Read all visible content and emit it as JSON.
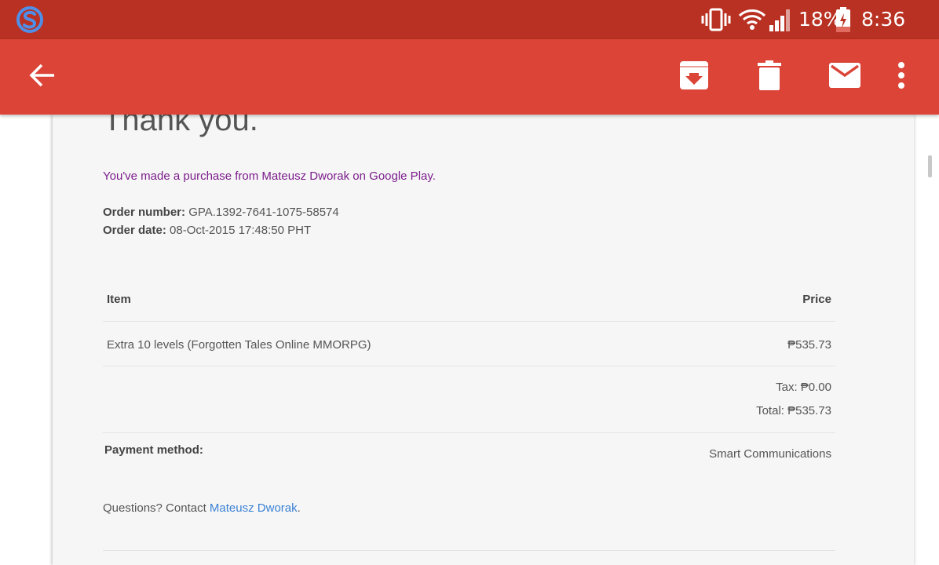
{
  "status_bar": {
    "battery": "18%",
    "time": "8:36 pm",
    "icons": [
      "s-logo-icon",
      "vibrate-icon",
      "wifi-icon",
      "signal-icon",
      "battery-charging-icon"
    ]
  },
  "app_bar": {
    "icons": [
      "back-arrow-icon",
      "archive-icon",
      "delete-icon",
      "mark-unread-icon",
      "more-vert-icon"
    ]
  },
  "email": {
    "headline": "Thank you.",
    "intro": "You've made a purchase from Mateusz Dworak on Google Play.",
    "order_number_label": "Order number:",
    "order_number": "GPA.1392-7641-1075-58574",
    "order_date_label": "Order date:",
    "order_date": "08-Oct-2015 17:48:50 PHT",
    "table": {
      "header_item": "Item",
      "header_price": "Price",
      "item_name": "Extra 10 levels (Forgotten Tales Online MMORPG)",
      "item_price": "₱535.73",
      "tax": "Tax: ₱0.00",
      "total": "Total: ₱535.73"
    },
    "payment_label": "Payment method:",
    "payment_value": "Smart Communications",
    "questions_prefix": "Questions? Contact ",
    "questions_link": "Mateusz Dworak",
    "questions_suffix": "."
  },
  "colors": {
    "status_bar": "#b93122",
    "app_bar": "#db4437",
    "intro_text": "#7b1d8b",
    "link": "#3b82d6"
  }
}
